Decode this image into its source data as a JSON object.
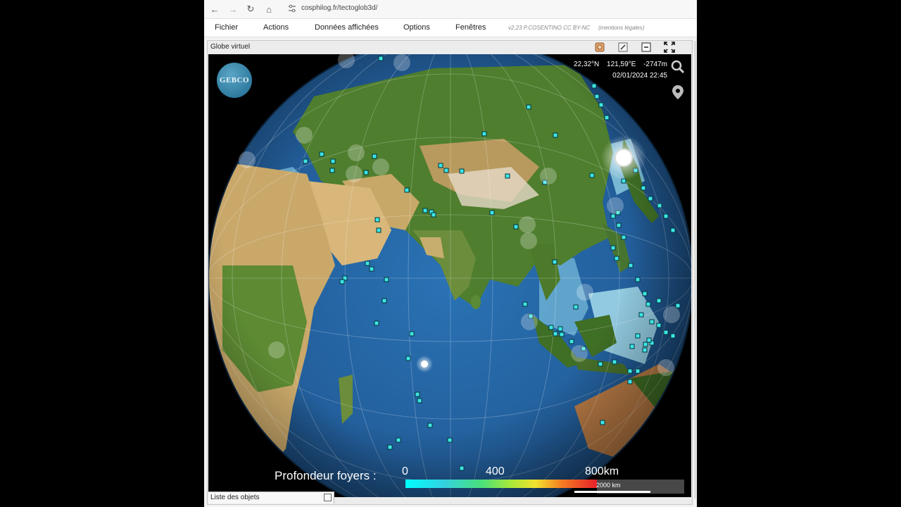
{
  "browser": {
    "url": "cosphilog.fr/tectoglob3d/",
    "back_glyph": "←",
    "forward_glyph": "→",
    "reload_glyph": "↻",
    "home_glyph": "⌂"
  },
  "menu": {
    "items": [
      "Fichier",
      "Actions",
      "Données affichées",
      "Options",
      "Fenêtres"
    ],
    "version": "v2.23 P.COSENTINO CC BY-NC",
    "legal": "(mentions légales)"
  },
  "window": {
    "title": "Globe virtuel"
  },
  "globe": {
    "logo": "GEBCO",
    "lat": "22,32°N",
    "lon": "121,59°E",
    "depth": "-2747m",
    "datetime": "02/01/2024 22:45",
    "legend_label": "Profondeur foyers :",
    "legend_ticks": [
      "0",
      "400",
      "800km"
    ],
    "scale_label": "2000 km"
  },
  "bottom": {
    "list_label": "Liste des objets"
  },
  "colors": {
    "ocean_deep": "#1f5e9e",
    "ocean_shallow": "#9fd6e8",
    "land_green": "#4a7a2a",
    "land_desert": "#d8b87a",
    "quake_marker": "#3ce6e6"
  }
}
